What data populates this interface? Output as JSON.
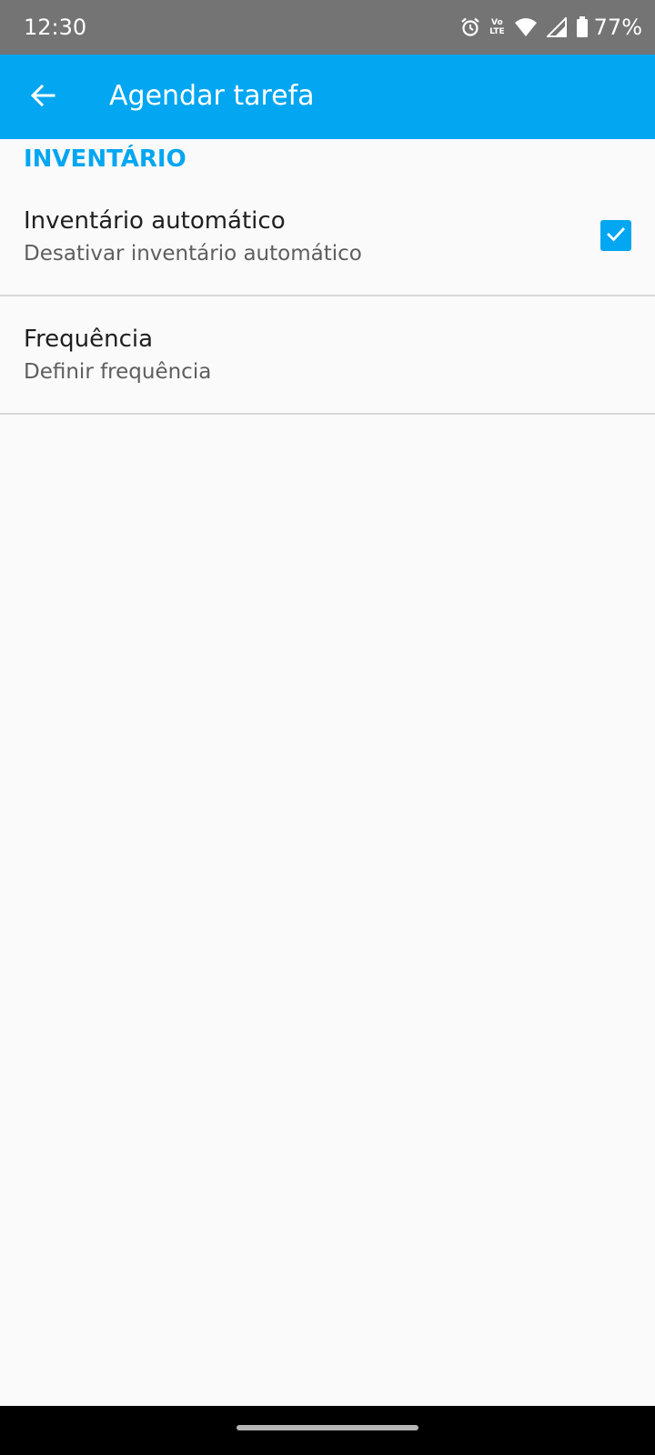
{
  "status_bar": {
    "time": "12:30",
    "volte_top": "Vo",
    "volte_bottom": "LTE",
    "battery_percent": "77%",
    "icons": [
      "alarm-icon",
      "volte-icon",
      "wifi-icon",
      "signal-icon",
      "battery-icon"
    ]
  },
  "app_bar": {
    "back_icon": "arrow-back-icon",
    "title": "Agendar tarefa"
  },
  "section": {
    "header": "INVENTÁRIO"
  },
  "preferences": [
    {
      "title": "Inventário automático",
      "summary": "Desativar inventário automático",
      "checked": true
    },
    {
      "title": "Frequência",
      "summary": "Definir frequência"
    }
  ],
  "colors": {
    "accent": "#02a6f1",
    "status_bar": "#747474",
    "background": "#fafafa",
    "divider": "#d8d8d8"
  }
}
